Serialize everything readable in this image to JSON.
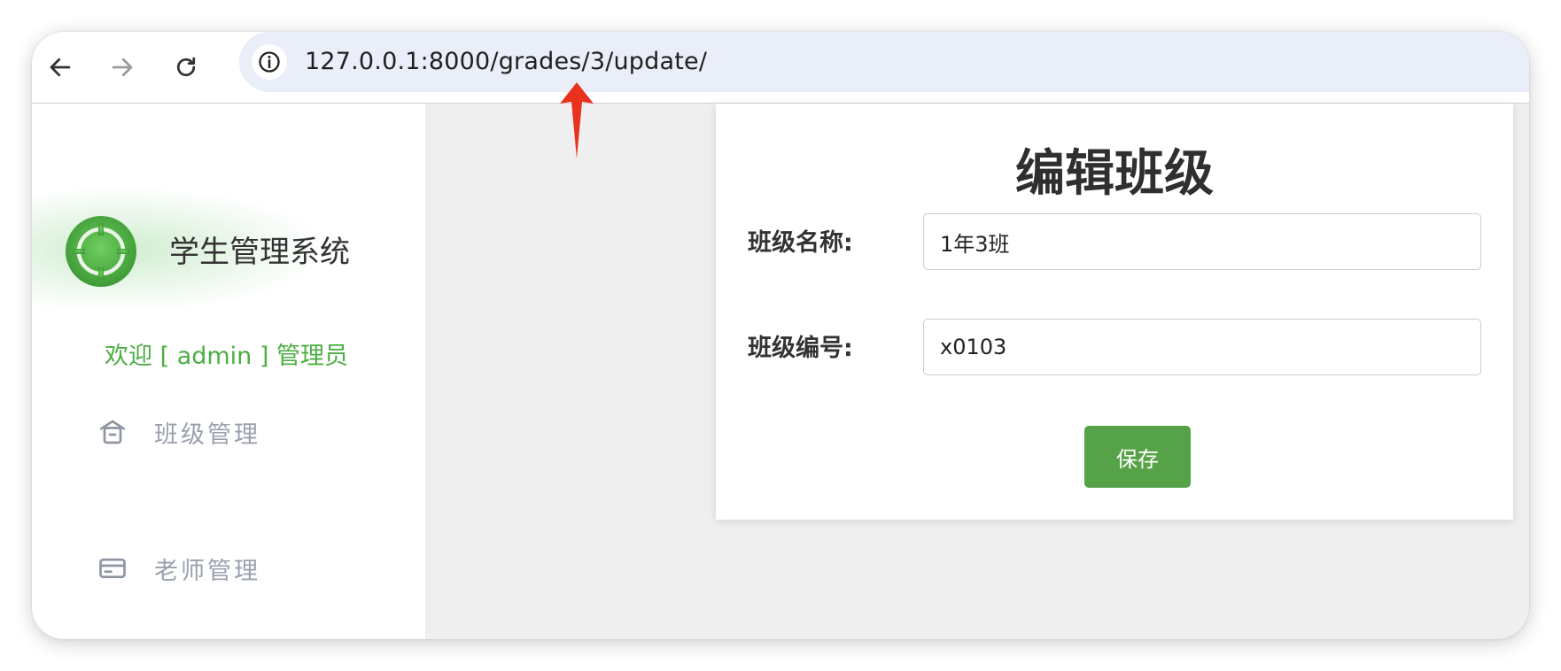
{
  "browser": {
    "url": "127.0.0.1:8000/grades/3/update/",
    "icons": {
      "back": "arrow-left-icon",
      "forward": "arrow-right-icon",
      "reload": "reload-icon",
      "site_info": "info-icon"
    }
  },
  "sidebar": {
    "brand_title": "学生管理系统",
    "welcome": "欢迎 [ admin ] 管理员",
    "menu": [
      {
        "label": "班级管理",
        "icon": "house-icon"
      },
      {
        "label": "老师管理",
        "icon": "card-icon"
      }
    ]
  },
  "form": {
    "title": "编辑班级",
    "fields": [
      {
        "label": "班级名称:",
        "value": "1年3班"
      },
      {
        "label": "班级编号:",
        "value": "x0103"
      }
    ],
    "save_label": "保存"
  },
  "colors": {
    "accent_green": "#4cae42",
    "button_green": "#55a248",
    "annotation_red": "#e8321e",
    "omnibox_bg": "#e9eef8"
  }
}
